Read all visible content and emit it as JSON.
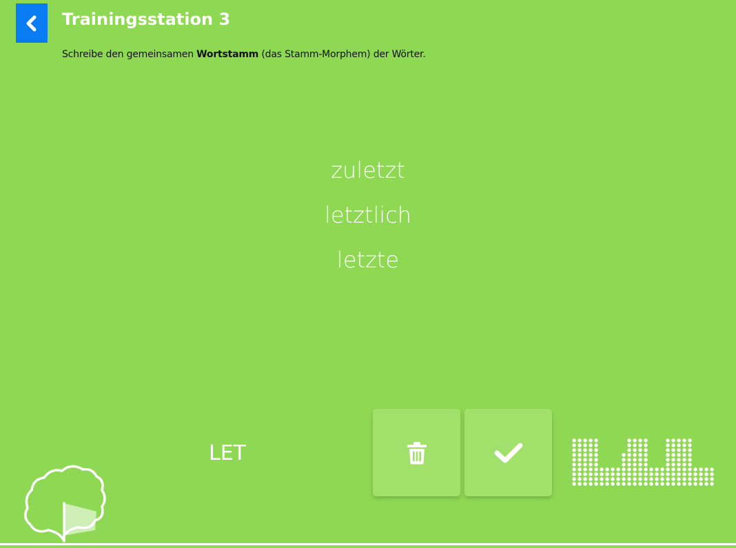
{
  "header": {
    "back_icon": "chevron-left-icon",
    "title": "Trainingsstation 3"
  },
  "instruction": {
    "before": "Schreibe den gemeinsamen ",
    "bold": "Wortstamm",
    "after": " (das Stamm-Morphem) der Wörter."
  },
  "words": [
    "zuletzt",
    "letztlich",
    "letzte"
  ],
  "answer": {
    "value": "LET"
  },
  "buttons": {
    "delete_icon": "trash-icon",
    "check_icon": "checkmark-icon"
  },
  "progress": {
    "icon": "dot-matrix-progress-icon"
  },
  "colors": {
    "background": "#8fd853",
    "back_button": "#0a7cf2",
    "button_fill": "#a2e06c",
    "text_light": "#ffffff"
  }
}
